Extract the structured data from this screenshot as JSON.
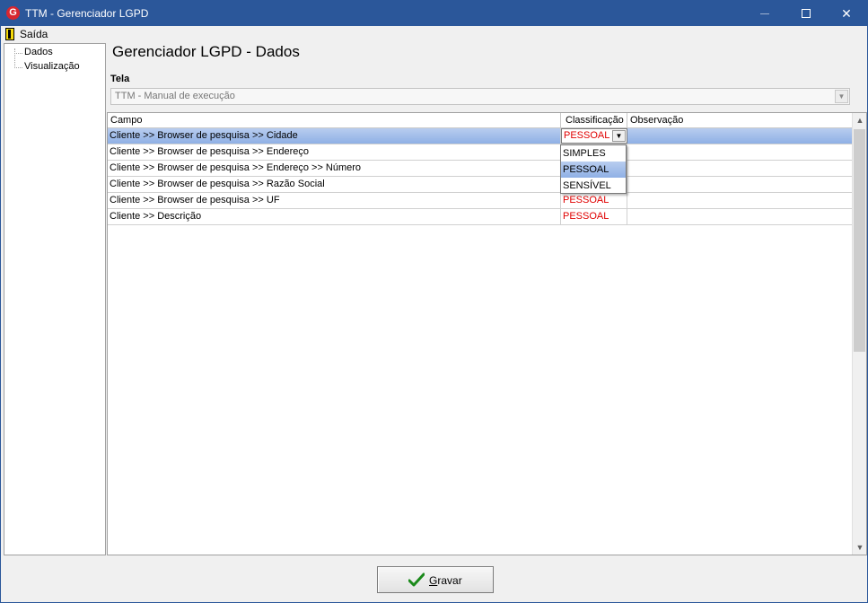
{
  "window": {
    "title": "TTM - Gerenciador LGPD",
    "app_icon_letter": "G"
  },
  "menu": {
    "saida_label": "Saída"
  },
  "tree": {
    "items": [
      {
        "label": "Dados"
      },
      {
        "label": "Visualização"
      }
    ]
  },
  "panel": {
    "title": "Gerenciador LGPD - Dados",
    "tela_label": "Tela",
    "tela_value": "TTM - Manual de execução"
  },
  "grid": {
    "columns": [
      "Campo",
      "Classificação",
      "Observação"
    ],
    "rows": [
      {
        "campo": "Cliente >> Browser de pesquisa >> Cidade",
        "classificacao": "PESSOAL",
        "observacao": ""
      },
      {
        "campo": "Cliente >> Browser de pesquisa >> Endereço",
        "classificacao": "",
        "observacao": ""
      },
      {
        "campo": "Cliente >> Browser de pesquisa >> Endereço >> Número",
        "classificacao": "",
        "observacao": ""
      },
      {
        "campo": "Cliente >> Browser de pesquisa >> Razão Social",
        "classificacao": "",
        "observacao": ""
      },
      {
        "campo": "Cliente >> Browser de pesquisa >> UF",
        "classificacao": "PESSOAL",
        "observacao": ""
      },
      {
        "campo": "Cliente >> Descrição",
        "classificacao": "PESSOAL",
        "observacao": ""
      }
    ],
    "editor_value": "PESSOAL",
    "dropdown_options": [
      "SIMPLES",
      "PESSOAL",
      "SENSÍVEL"
    ],
    "dropdown_highlighted": "PESSOAL"
  },
  "footer": {
    "gravar_label": "Gravar"
  },
  "colors": {
    "titlebar": "#2b579a",
    "classificacao_text": "#e00000",
    "selection": "#9db9e8"
  }
}
